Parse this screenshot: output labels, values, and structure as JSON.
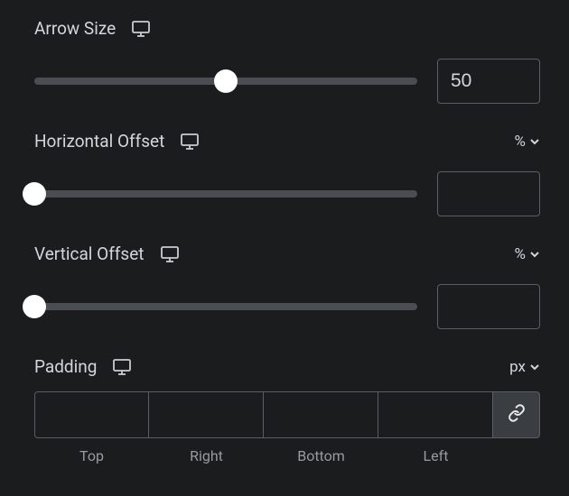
{
  "arrowSize": {
    "label": "Arrow Size",
    "value": "50",
    "sliderPercent": 50
  },
  "horizontalOffset": {
    "label": "Horizontal Offset",
    "unit": "%",
    "value": "",
    "sliderPercent": 0
  },
  "verticalOffset": {
    "label": "Vertical Offset",
    "unit": "%",
    "value": "",
    "sliderPercent": 0
  },
  "padding": {
    "label": "Padding",
    "unit": "px",
    "top": "",
    "right": "",
    "bottom": "",
    "left": "",
    "labels": {
      "top": "Top",
      "right": "Right",
      "bottom": "Bottom",
      "left": "Left"
    }
  }
}
